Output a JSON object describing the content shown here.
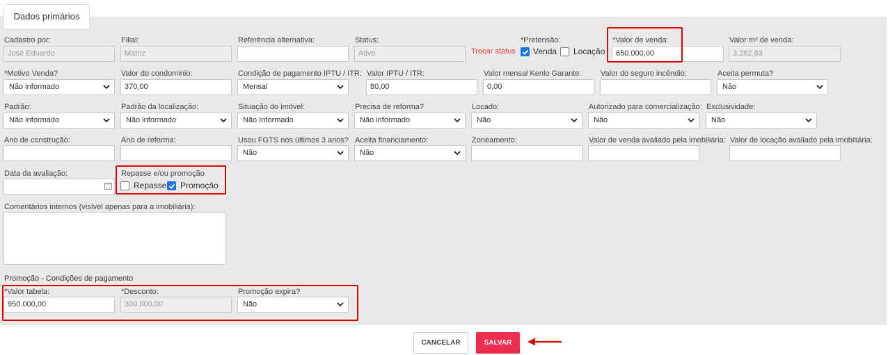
{
  "tab": {
    "label": "Dados primários"
  },
  "fields": {
    "cadastro_por": {
      "label": "Cadastro por:",
      "value": "José Eduardo"
    },
    "filial": {
      "label": "Filial:",
      "value": "Matriz"
    },
    "referencia": {
      "label": "Referência alternativa:",
      "value": ""
    },
    "status": {
      "label": "Status:",
      "value": "Ativo",
      "link": "Trocar status"
    },
    "pretensao": {
      "label": "*Pretensão:",
      "venda": "Venda",
      "locacao": "Locação",
      "venda_checked": true,
      "locacao_checked": false
    },
    "valor_venda": {
      "label": "*Valor de venda:",
      "value": "650.000,00"
    },
    "valor_m2": {
      "label": "Valor m² de venda:",
      "value": "3.282,83"
    },
    "motivo_venda": {
      "label": "*Motivo Venda?",
      "value": "Não informado"
    },
    "valor_condominio": {
      "label": "Valor do condominio:",
      "value": "370,00"
    },
    "condicao_iptu": {
      "label": "Condição de pagamento IPTU / ITR:",
      "value": "Mensal"
    },
    "valor_iptu": {
      "label": "Valor IPTU / ITR:",
      "value": "80,00"
    },
    "valor_kenlo": {
      "label": "Valor mensal Kenlo Garante:",
      "value": "0,00"
    },
    "seguro_incendio": {
      "label": "Valor do seguro incêndio:",
      "value": ""
    },
    "aceita_permuta": {
      "label": "Aceita permuta?",
      "value": "Não"
    },
    "padrao": {
      "label": "Padrão:",
      "value": "Não informado"
    },
    "padrao_localizacao": {
      "label": "Padrão da localização:",
      "value": "Não informado"
    },
    "situacao_imovel": {
      "label": "Situação do imóvel:",
      "value": "Não Informado"
    },
    "precisa_reforma": {
      "label": "Precisa de reforma?",
      "value": "Não informado"
    },
    "locado": {
      "label": "Locado:",
      "value": "Não"
    },
    "autorizado": {
      "label": "Autorizado para comercialização:",
      "value": "Não"
    },
    "exclusividade": {
      "label": "Exclusividade:",
      "value": "Não"
    },
    "ano_construcao": {
      "label": "Ano de construção:",
      "value": ""
    },
    "ano_reforma": {
      "label": "Ano de reforma:",
      "value": ""
    },
    "usou_fgts": {
      "label": "Usou FGTS nos últimos 3 anos?",
      "value": "Não"
    },
    "aceita_financiamento": {
      "label": "Aceita financiamento:",
      "value": "Não"
    },
    "zoneamento": {
      "label": "Zoneamento:",
      "value": ""
    },
    "valor_venda_avaliado": {
      "label": "Valor de venda avaliado pela imobiliária:",
      "value": ""
    },
    "valor_locacao_avaliado": {
      "label": "Valor de locação avaliado pela imobiliária:",
      "value": ""
    },
    "data_avaliacao": {
      "label": "Data da avaliação:",
      "value": ""
    },
    "repasse_promocao": {
      "label": "Repasse e/ou promoção",
      "repasse": "Repasse",
      "promocao": "Promoção",
      "repasse_checked": false,
      "promocao_checked": true
    },
    "comentarios": {
      "label": "Comentários internos (visível apenas para a imobiliária):",
      "value": ""
    }
  },
  "promocao": {
    "title": "Promoção - Condições de pagamento",
    "valor_tabela": {
      "label": "*Valor tabela:",
      "value": "950.000,00"
    },
    "desconto": {
      "label": "*Desconto:",
      "value": "300.000,00"
    },
    "expira": {
      "label": "Promoção expira?",
      "value": "Não"
    }
  },
  "actions": {
    "cancel": "CANCELAR",
    "save": "SALVAR"
  },
  "colors": {
    "highlight": "#e00000",
    "save_button": "#ec2d4e",
    "checkbox": "#1a73e8",
    "link": "#e23b3b"
  }
}
